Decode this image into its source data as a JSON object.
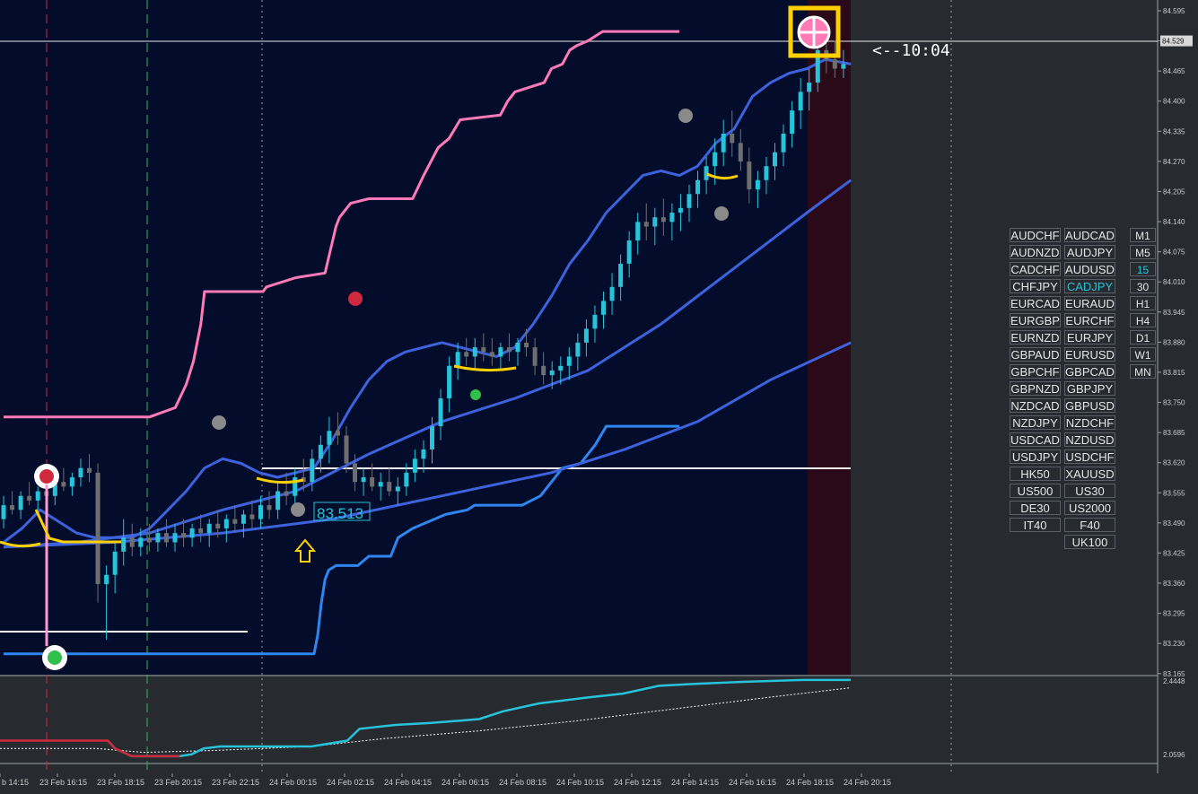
{
  "chart_data": {
    "type": "candlestick",
    "instrument": "CADJPY",
    "timeframe": "15",
    "price_axis": [
      "84.595",
      "84.529",
      "84.465",
      "84.400",
      "84.335",
      "84.270",
      "84.205",
      "84.140",
      "84.075",
      "84.010",
      "83.945",
      "83.880",
      "83.815",
      "83.750",
      "83.685",
      "83.620",
      "83.555",
      "83.490",
      "83.425",
      "83.360",
      "83.295",
      "83.230",
      "83.165"
    ],
    "current_price": "84.529",
    "time_labels": [
      "b 14:15",
      "23 Feb 16:15",
      "23 Feb 18:15",
      "23 Feb 20:15",
      "23 Feb 22:15",
      "24 Feb 00:15",
      "24 Feb 02:15",
      "24 Feb 04:15",
      "24 Feb 06:15",
      "24 Feb 08:15",
      "24 Feb 10:15",
      "24 Feb 12:15",
      "24 Feb 14:15",
      "24 Feb 16:15",
      "24 Feb 18:15",
      "24 Feb 20:15"
    ],
    "indicator_axis": [
      "2.4448",
      "2.0596"
    ],
    "price_label": "83.513",
    "timer_label": "<--10:04",
    "upper_channel": [
      [
        0,
        83.72
      ],
      [
        40,
        83.72
      ],
      [
        47,
        83.74
      ],
      [
        50,
        83.79
      ],
      [
        52,
        83.84
      ],
      [
        54,
        83.92
      ],
      [
        55,
        83.99
      ],
      [
        71,
        83.99
      ],
      [
        72,
        84.0
      ],
      [
        80,
        84.02
      ],
      [
        88,
        84.03
      ],
      [
        91,
        84.13
      ],
      [
        92,
        84.15
      ],
      [
        95,
        84.18
      ],
      [
        100,
        84.19
      ],
      [
        112,
        84.19
      ],
      [
        115,
        84.24
      ],
      [
        119,
        84.3
      ],
      [
        122,
        84.32
      ],
      [
        125,
        84.36
      ],
      [
        136,
        84.37
      ],
      [
        138,
        84.4
      ],
      [
        140,
        84.42
      ],
      [
        148,
        84.44
      ],
      [
        150,
        84.47
      ],
      [
        153,
        84.48
      ],
      [
        155,
        84.51
      ],
      [
        157,
        84.52
      ],
      [
        160,
        84.53
      ],
      [
        164,
        84.55
      ],
      [
        185,
        84.55
      ]
    ],
    "lower_channel": [
      [
        0,
        83.21
      ],
      [
        85,
        83.21
      ],
      [
        86,
        83.25
      ],
      [
        87,
        83.32
      ],
      [
        88,
        83.37
      ],
      [
        89,
        83.39
      ],
      [
        91,
        83.4
      ],
      [
        97,
        83.4
      ],
      [
        100,
        83.42
      ],
      [
        106,
        83.42
      ],
      [
        108,
        83.46
      ],
      [
        112,
        83.48
      ],
      [
        115,
        83.49
      ],
      [
        121,
        83.51
      ],
      [
        127,
        83.52
      ],
      [
        129,
        83.53
      ],
      [
        142,
        83.53
      ],
      [
        147,
        83.55
      ],
      [
        151,
        83.59
      ],
      [
        153,
        83.61
      ],
      [
        158,
        83.62
      ],
      [
        162,
        83.66
      ],
      [
        165,
        83.7
      ],
      [
        185,
        83.7
      ]
    ],
    "ma_fast": [
      [
        0,
        83.45
      ],
      [
        5,
        83.48
      ],
      [
        10,
        83.52
      ],
      [
        14,
        83.5
      ],
      [
        20,
        83.47
      ],
      [
        25,
        83.46
      ],
      [
        30,
        83.46
      ],
      [
        35,
        83.46
      ],
      [
        40,
        83.48
      ],
      [
        45,
        83.52
      ],
      [
        50,
        83.56
      ],
      [
        55,
        83.61
      ],
      [
        60,
        83.63
      ],
      [
        65,
        83.62
      ],
      [
        70,
        83.6
      ],
      [
        75,
        83.59
      ],
      [
        80,
        83.6
      ],
      [
        85,
        83.61
      ],
      [
        90,
        83.67
      ],
      [
        95,
        83.74
      ],
      [
        100,
        83.8
      ],
      [
        105,
        83.84
      ],
      [
        110,
        83.86
      ],
      [
        115,
        83.87
      ],
      [
        120,
        83.88
      ],
      [
        125,
        83.87
      ],
      [
        130,
        83.86
      ],
      [
        135,
        83.85
      ],
      [
        140,
        83.87
      ],
      [
        145,
        83.92
      ],
      [
        150,
        83.98
      ],
      [
        155,
        84.05
      ],
      [
        160,
        84.1
      ],
      [
        165,
        84.16
      ],
      [
        170,
        84.2
      ],
      [
        175,
        84.24
      ],
      [
        180,
        84.25
      ],
      [
        185,
        84.24
      ],
      [
        190,
        84.26
      ],
      [
        195,
        84.31
      ],
      [
        200,
        84.34
      ],
      [
        205,
        84.41
      ],
      [
        210,
        84.44
      ],
      [
        215,
        84.46
      ],
      [
        220,
        84.47
      ],
      [
        225,
        84.49
      ],
      [
        232,
        84.48
      ]
    ],
    "ma_slow": [
      [
        0,
        83.44
      ],
      [
        20,
        83.45
      ],
      [
        40,
        83.47
      ],
      [
        60,
        83.52
      ],
      [
        80,
        83.56
      ],
      [
        100,
        83.64
      ],
      [
        120,
        83.71
      ],
      [
        140,
        83.76
      ],
      [
        160,
        83.82
      ],
      [
        180,
        83.92
      ],
      [
        200,
        84.04
      ],
      [
        220,
        84.16
      ],
      [
        232,
        84.23
      ]
    ],
    "ma_long": [
      [
        0,
        83.44
      ],
      [
        30,
        83.45
      ],
      [
        60,
        83.47
      ],
      [
        90,
        83.5
      ],
      [
        120,
        83.55
      ],
      [
        150,
        83.6
      ],
      [
        170,
        83.65
      ],
      [
        190,
        83.71
      ],
      [
        210,
        83.8
      ],
      [
        232,
        83.88
      ]
    ],
    "candles": [
      [
        0,
        83.5,
        83.55,
        83.48,
        83.53
      ],
      [
        1,
        83.53,
        83.56,
        83.51,
        83.52
      ],
      [
        2,
        83.52,
        83.56,
        83.5,
        83.55
      ],
      [
        3,
        83.55,
        83.58,
        83.53,
        83.54
      ],
      [
        4,
        83.54,
        83.57,
        83.52,
        83.56
      ],
      [
        5,
        83.56,
        83.59,
        83.54,
        83.55
      ],
      [
        6,
        83.55,
        83.6,
        83.53,
        83.58
      ],
      [
        7,
        83.58,
        83.61,
        83.56,
        83.57
      ],
      [
        8,
        83.57,
        83.6,
        83.55,
        83.59
      ],
      [
        9,
        83.59,
        83.63,
        83.57,
        83.61
      ],
      [
        10,
        83.61,
        83.64,
        83.58,
        83.6
      ],
      [
        11,
        83.6,
        83.62,
        83.32,
        83.36
      ],
      [
        12,
        83.36,
        83.4,
        83.24,
        83.38
      ],
      [
        13,
        83.38,
        83.45,
        83.34,
        83.43
      ],
      [
        14,
        83.43,
        83.5,
        83.4,
        83.46
      ],
      [
        15,
        83.46,
        83.49,
        83.42,
        83.44
      ],
      [
        16,
        83.44,
        83.48,
        83.42,
        83.46
      ],
      [
        17,
        83.46,
        83.49,
        83.43,
        83.45
      ],
      [
        18,
        83.45,
        83.48,
        83.43,
        83.47
      ],
      [
        19,
        83.47,
        83.5,
        83.44,
        83.45
      ],
      [
        20,
        83.45,
        83.49,
        83.43,
        83.47
      ],
      [
        21,
        83.47,
        83.5,
        83.44,
        83.46
      ],
      [
        22,
        83.46,
        83.49,
        83.44,
        83.48
      ],
      [
        23,
        83.48,
        83.51,
        83.45,
        83.47
      ],
      [
        24,
        83.47,
        83.5,
        83.44,
        83.49
      ],
      [
        25,
        83.49,
        83.52,
        83.46,
        83.48
      ],
      [
        26,
        83.48,
        83.51,
        83.45,
        83.5
      ],
      [
        27,
        83.5,
        83.53,
        83.47,
        83.49
      ],
      [
        28,
        83.49,
        83.52,
        83.46,
        83.51
      ],
      [
        29,
        83.51,
        83.54,
        83.48,
        83.5
      ],
      [
        30,
        83.5,
        83.55,
        83.48,
        83.53
      ],
      [
        31,
        83.53,
        83.56,
        83.5,
        83.52
      ],
      [
        32,
        83.52,
        83.58,
        83.5,
        83.56
      ],
      [
        33,
        83.56,
        83.6,
        83.53,
        83.55
      ],
      [
        34,
        83.55,
        83.61,
        83.53,
        83.59
      ],
      [
        35,
        83.59,
        83.63,
        83.56,
        83.58
      ],
      [
        36,
        83.58,
        83.65,
        83.56,
        83.63
      ],
      [
        37,
        83.63,
        83.68,
        83.6,
        83.66
      ],
      [
        38,
        83.66,
        83.72,
        83.62,
        83.69
      ],
      [
        39,
        83.69,
        83.73,
        83.66,
        83.68
      ],
      [
        40,
        83.68,
        83.7,
        83.6,
        83.62
      ],
      [
        41,
        83.62,
        83.64,
        83.56,
        83.58
      ],
      [
        42,
        83.58,
        83.61,
        83.55,
        83.59
      ],
      [
        43,
        83.59,
        83.62,
        83.56,
        83.57
      ],
      [
        44,
        83.57,
        83.6,
        83.54,
        83.58
      ],
      [
        45,
        83.58,
        83.61,
        83.55,
        83.56
      ],
      [
        46,
        83.56,
        83.59,
        83.53,
        83.57
      ],
      [
        47,
        83.57,
        83.62,
        83.55,
        83.6
      ],
      [
        48,
        83.6,
        83.65,
        83.58,
        83.63
      ],
      [
        49,
        83.63,
        83.67,
        83.6,
        83.65
      ],
      [
        50,
        83.65,
        83.72,
        83.62,
        83.7
      ],
      [
        51,
        83.7,
        83.78,
        83.67,
        83.76
      ],
      [
        52,
        83.76,
        83.85,
        83.73,
        83.83
      ],
      [
        53,
        83.83,
        83.88,
        83.8,
        83.86
      ],
      [
        54,
        83.86,
        83.89,
        83.83,
        83.85
      ],
      [
        55,
        83.85,
        83.89,
        83.82,
        83.87
      ],
      [
        56,
        83.87,
        83.9,
        83.84,
        83.86
      ],
      [
        57,
        83.86,
        83.89,
        83.83,
        83.85
      ],
      [
        58,
        83.85,
        83.88,
        83.82,
        83.87
      ],
      [
        59,
        83.87,
        83.9,
        83.84,
        83.86
      ],
      [
        60,
        83.86,
        83.89,
        83.83,
        83.88
      ],
      [
        61,
        83.88,
        83.91,
        83.85,
        83.87
      ],
      [
        62,
        83.87,
        83.89,
        83.81,
        83.83
      ],
      [
        63,
        83.83,
        83.86,
        83.79,
        83.81
      ],
      [
        64,
        83.81,
        83.84,
        83.78,
        83.82
      ],
      [
        65,
        83.82,
        83.85,
        83.79,
        83.83
      ],
      [
        66,
        83.83,
        83.87,
        83.8,
        83.85
      ],
      [
        67,
        83.85,
        83.9,
        83.82,
        83.88
      ],
      [
        68,
        83.88,
        83.93,
        83.85,
        83.91
      ],
      [
        69,
        83.91,
        83.96,
        83.88,
        83.94
      ],
      [
        70,
        83.94,
        83.99,
        83.91,
        83.97
      ],
      [
        71,
        83.97,
        84.03,
        83.94,
        84.0
      ],
      [
        72,
        84.0,
        84.07,
        83.97,
        84.05
      ],
      [
        73,
        84.05,
        84.12,
        84.02,
        84.1
      ],
      [
        74,
        84.1,
        84.16,
        84.07,
        84.14
      ],
      [
        75,
        84.14,
        84.18,
        84.1,
        84.13
      ],
      [
        76,
        84.13,
        84.17,
        84.09,
        84.15
      ],
      [
        77,
        84.15,
        84.19,
        84.11,
        84.14
      ],
      [
        78,
        84.14,
        84.18,
        84.1,
        84.16
      ],
      [
        79,
        84.16,
        84.2,
        84.12,
        84.17
      ],
      [
        80,
        84.17,
        84.22,
        84.14,
        84.2
      ],
      [
        81,
        84.2,
        84.25,
        84.17,
        84.23
      ],
      [
        82,
        84.23,
        84.28,
        84.2,
        84.26
      ],
      [
        83,
        84.26,
        84.32,
        84.22,
        84.29
      ],
      [
        84,
        84.29,
        84.36,
        84.26,
        84.33
      ],
      [
        85,
        84.33,
        84.38,
        84.28,
        84.31
      ],
      [
        86,
        84.31,
        84.34,
        84.25,
        84.27
      ],
      [
        87,
        84.27,
        84.3,
        84.18,
        84.21
      ],
      [
        88,
        84.21,
        84.25,
        84.17,
        84.23
      ],
      [
        89,
        84.23,
        84.28,
        84.2,
        84.26
      ],
      [
        90,
        84.26,
        84.31,
        84.23,
        84.29
      ],
      [
        91,
        84.29,
        84.35,
        84.26,
        84.33
      ],
      [
        92,
        84.33,
        84.4,
        84.3,
        84.38
      ],
      [
        93,
        84.38,
        84.45,
        84.34,
        84.42
      ],
      [
        94,
        84.42,
        84.47,
        84.38,
        84.44
      ],
      [
        95,
        84.44,
        84.54,
        84.42,
        84.51
      ],
      [
        96,
        84.51,
        84.55,
        84.46,
        84.49
      ],
      [
        97,
        84.49,
        84.53,
        84.45,
        84.47
      ],
      [
        98,
        84.47,
        84.51,
        84.45,
        84.48
      ]
    ],
    "indicator_main": [
      [
        0,
        2.14
      ],
      [
        45,
        2.14
      ],
      [
        48,
        2.1
      ],
      [
        55,
        2.06
      ],
      [
        75,
        2.06
      ],
      [
        80,
        2.07
      ],
      [
        85,
        2.1
      ],
      [
        92,
        2.11
      ],
      [
        130,
        2.11
      ],
      [
        145,
        2.14
      ],
      [
        150,
        2.2
      ],
      [
        165,
        2.22
      ],
      [
        180,
        2.23
      ],
      [
        200,
        2.25
      ],
      [
        210,
        2.29
      ],
      [
        225,
        2.33
      ],
      [
        245,
        2.36
      ],
      [
        260,
        2.38
      ],
      [
        275,
        2.42
      ],
      [
        290,
        2.43
      ],
      [
        310,
        2.44
      ],
      [
        335,
        2.45
      ],
      [
        355,
        2.45
      ]
    ],
    "indicator_signal": [
      [
        0,
        2.1
      ],
      [
        40,
        2.1
      ],
      [
        60,
        2.08
      ],
      [
        90,
        2.09
      ],
      [
        130,
        2.11
      ],
      [
        160,
        2.15
      ],
      [
        200,
        2.19
      ],
      [
        240,
        2.24
      ],
      [
        280,
        2.3
      ],
      [
        320,
        2.36
      ],
      [
        355,
        2.41
      ]
    ]
  },
  "symbols_col1": [
    "AUDCHF",
    "AUDNZD",
    "CADCHF",
    "CHFJPY",
    "EURCAD",
    "EURGBP",
    "EURNZD",
    "GBPAUD",
    "GBPCHF",
    "GBPNZD",
    "NZDCAD",
    "NZDJPY",
    "USDCAD",
    "USDJPY",
    "HK50",
    "US500",
    "DE30",
    "IT40"
  ],
  "symbols_col2": [
    "AUDCAD",
    "AUDJPY",
    "AUDUSD",
    "CADJPY",
    "EURAUD",
    "EURCHF",
    "EURJPY",
    "EURUSD",
    "GBPCAD",
    "GBPJPY",
    "GBPUSD",
    "NZDCHF",
    "NZDUSD",
    "USDCHF",
    "XAUUSD",
    "US30",
    "US2000",
    "F40",
    "UK100"
  ],
  "timeframes": [
    "M1",
    "M5",
    "15",
    "30",
    "H1",
    "H4",
    "D1",
    "W1",
    "MN"
  ],
  "active_symbol": "CADJPY",
  "active_timeframe": "15",
  "colors": {
    "background": "#030d2b",
    "page": "#272b30",
    "upper_channel": "#ff7ab6",
    "lower_channel": "#2f86f0",
    "ma": "#3d62dd",
    "bull": "#27c3d8",
    "bear": "#6e6e6e",
    "indicator": "#27c3d8",
    "indicator_low": "#d0283c",
    "highlight": "#ffd000",
    "session": "#2a0a18"
  }
}
